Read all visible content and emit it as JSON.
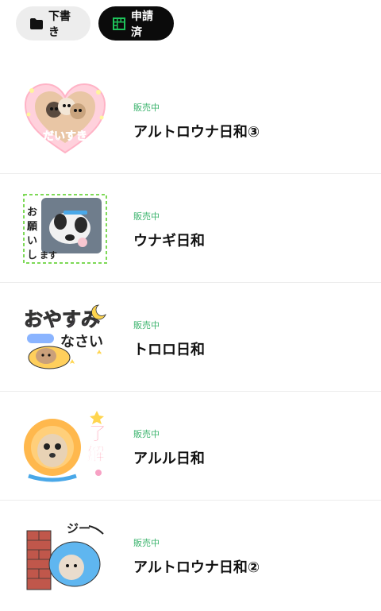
{
  "tabs": [
    {
      "label": "下書き",
      "icon": "folder-icon",
      "active": false
    },
    {
      "label": "申請済",
      "icon": "grid-icon",
      "active": true
    }
  ],
  "accent_color": "#3cb46e",
  "items": [
    {
      "status": "販売中",
      "title": "アルトロウナ日和③",
      "sticker_text": "だいすき",
      "icon": "sticker-thumbnail-daisuki"
    },
    {
      "status": "販売中",
      "title": "ウナギ日和",
      "sticker_text": "よろしくお願いします",
      "icon": "sticker-thumbnail-yoroshiku"
    },
    {
      "status": "販売中",
      "title": "トロロ日和",
      "sticker_text": "おやすみなさい",
      "icon": "sticker-thumbnail-oyasumi"
    },
    {
      "status": "販売中",
      "title": "アルル日和",
      "sticker_text": "了解",
      "icon": "sticker-thumbnail-ryoukai"
    },
    {
      "status": "販売中",
      "title": "アルトロウナ日和②",
      "sticker_text": "ジー",
      "icon": "sticker-thumbnail-jii"
    }
  ]
}
